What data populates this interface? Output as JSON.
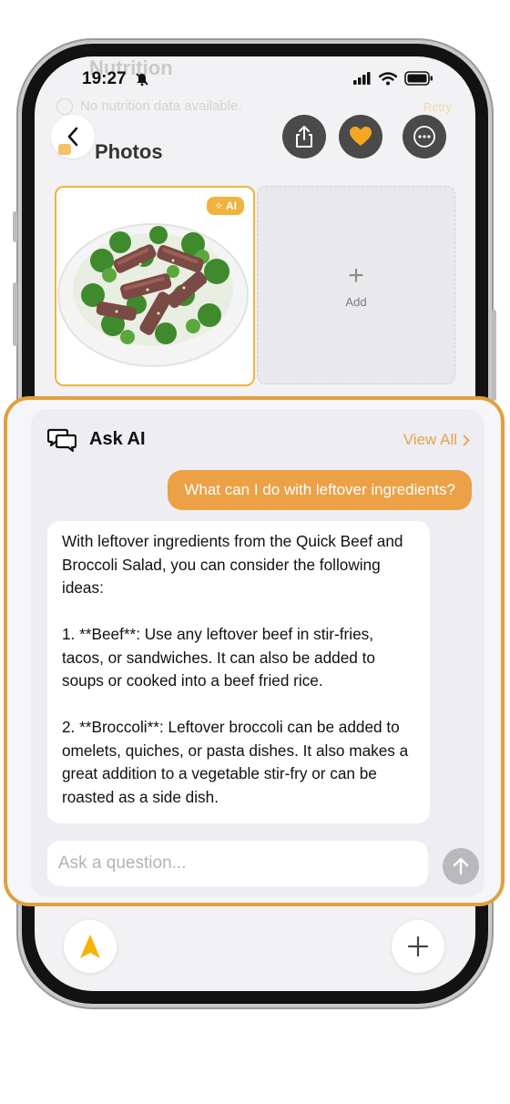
{
  "status_bar": {
    "time": "19:27"
  },
  "background_header": {
    "title": "Nutrition",
    "subtitle": "No nutrition data available.",
    "retry": "Retry"
  },
  "photos": {
    "title": "Photos",
    "ai_badge": "AI",
    "add_label": "Add"
  },
  "ask_ai": {
    "title": "Ask AI",
    "view_all": "View All",
    "user_question": "What can I do with leftover ingredients?",
    "answer": {
      "intro": "With leftover ingredients from the Quick Beef and Broccoli Salad, you can consider the following ideas:",
      "point1": "1. **Beef**: Use any leftover beef in stir-fries, tacos, or sandwiches. It can also be added to soups or cooked into a beef fried rice.",
      "point2": "2. **Broccoli**: Leftover broccoli can be added to omelets, quiches, or pasta dishes. It also makes a great addition to a vegetable stir-fry or can be roasted as a side dish."
    },
    "input_placeholder": "Ask a question..."
  },
  "colors": {
    "accent": "#E0A040",
    "bubble": "#ECA147",
    "dark_button": "#4A4A4A"
  }
}
